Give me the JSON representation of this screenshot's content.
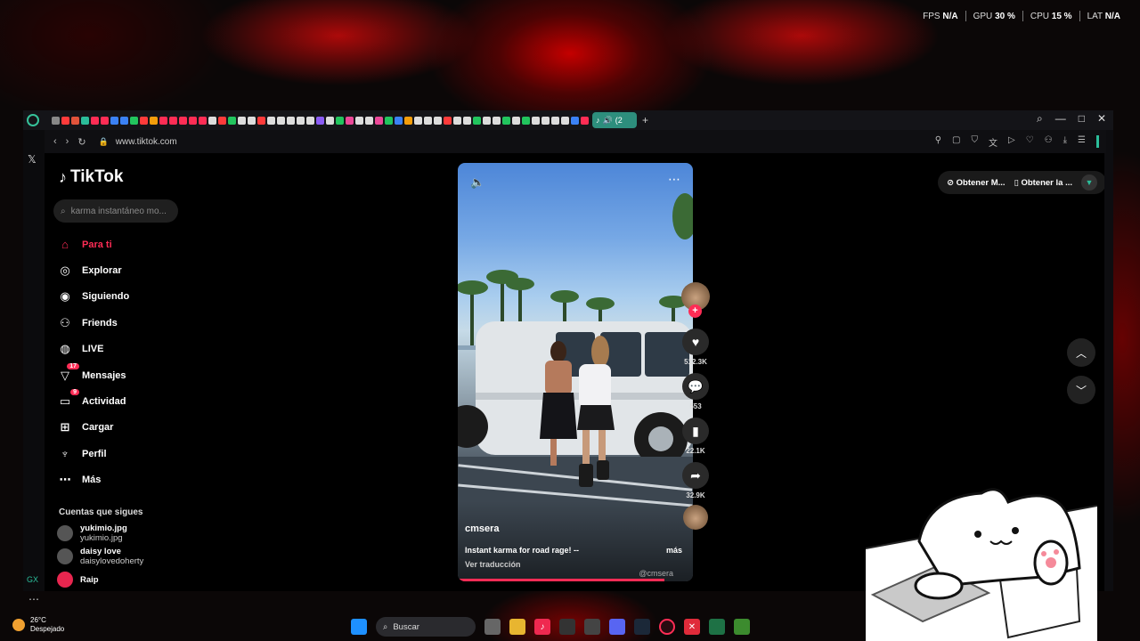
{
  "overlay": {
    "fps_label": "FPS",
    "fps_value": "N/A",
    "gpu_label": "GPU",
    "gpu_value": "30 %",
    "cpu_label": "CPU",
    "cpu_value": "15 %",
    "lat_label": "LAT",
    "lat_value": "N/A"
  },
  "browser": {
    "active_tab_count": "(2",
    "url": "www.tiktok.com",
    "accent": "#2bbd9a"
  },
  "tiktok": {
    "logo": "TikTok",
    "search_placeholder": "karma instantáneo mo...",
    "nav": [
      {
        "label": "Para ti",
        "icon": "home-icon"
      },
      {
        "label": "Explorar",
        "icon": "compass-icon"
      },
      {
        "label": "Siguiendo",
        "icon": "following-icon"
      },
      {
        "label": "Friends",
        "icon": "friends-icon"
      },
      {
        "label": "LIVE",
        "icon": "live-icon"
      },
      {
        "label": "Mensajes",
        "icon": "messages-icon",
        "badge": "17"
      },
      {
        "label": "Actividad",
        "icon": "activity-icon",
        "badge": "9"
      },
      {
        "label": "Cargar",
        "icon": "upload-icon"
      },
      {
        "label": "Perfil",
        "icon": "profile-icon"
      },
      {
        "label": "Más",
        "icon": "more-icon"
      }
    ],
    "following_heading": "Cuentas que sigues",
    "following": [
      {
        "name": "yukimio.jpg",
        "handle": "yukimio.jpg"
      },
      {
        "name": "daisy love",
        "handle": "daisylovedoherty"
      },
      {
        "name": "Raip",
        "handle": ""
      }
    ],
    "video": {
      "username": "cmsera",
      "caption": "Instant karma for road rage! --",
      "more": "más",
      "translate": "Ver traducción",
      "watermark": "@cmsera",
      "progress": 0.88
    },
    "actions": {
      "likes": "512.3K",
      "comments": "553",
      "saves": "22.1K",
      "shares": "32.9K"
    },
    "get_buttons": [
      "Obtener M...",
      "Obtener la ..."
    ]
  },
  "taskbar": {
    "temp": "26°C",
    "weather": "Despejado",
    "search_label": "Buscar"
  }
}
